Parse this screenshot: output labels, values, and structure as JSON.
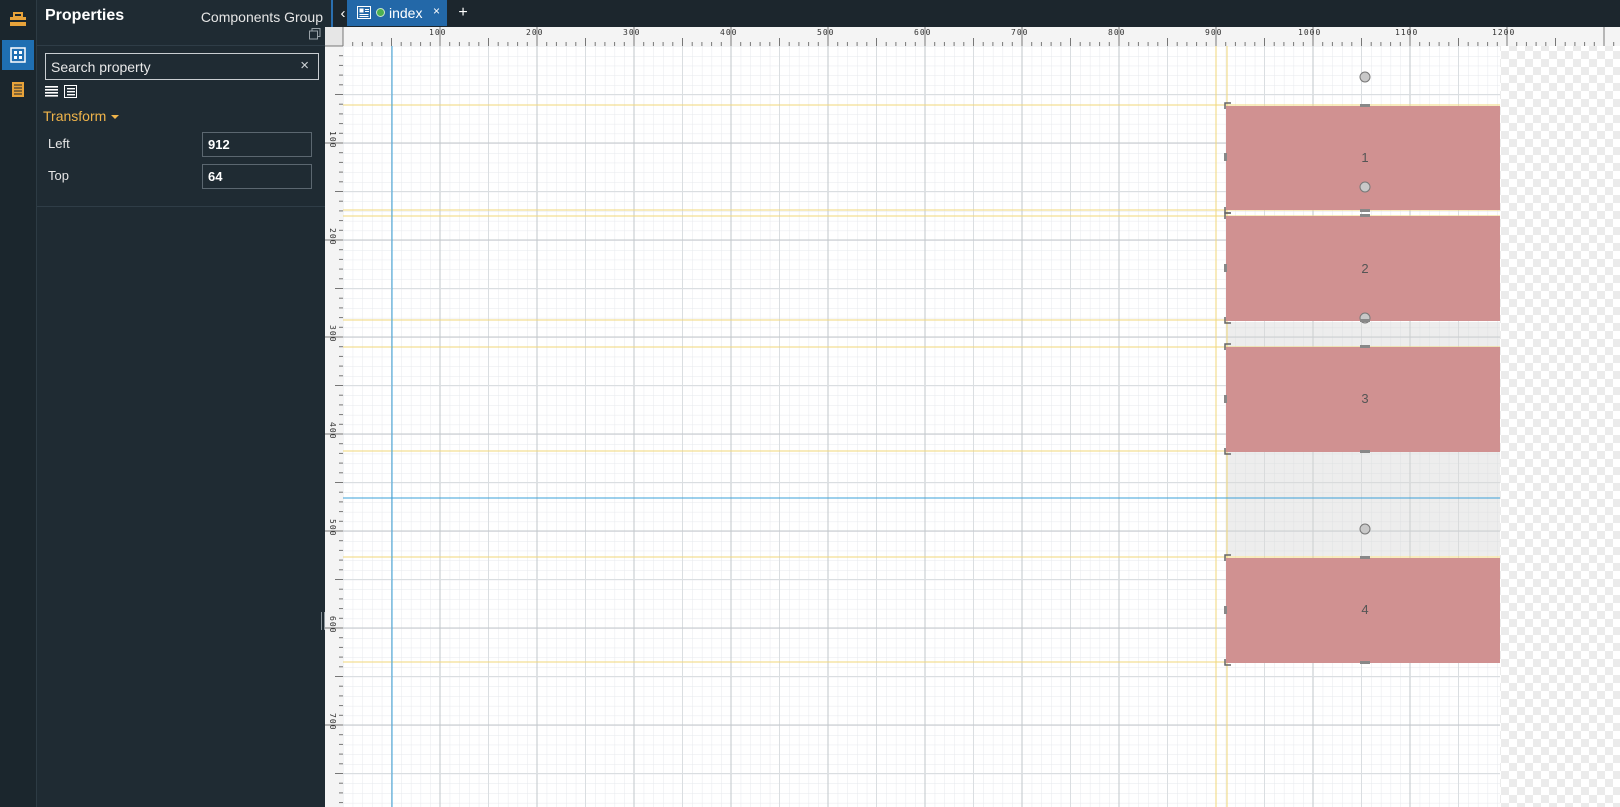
{
  "rail": {
    "items": [
      {
        "name": "toolbox-icon"
      },
      {
        "name": "layout-icon",
        "active": true
      },
      {
        "name": "page-icon"
      }
    ]
  },
  "panel": {
    "title": "Properties",
    "subtitle": "Components Group",
    "search_placeholder": "Search property",
    "search_clear": "×",
    "section": "Transform",
    "props": [
      {
        "label": "Left",
        "value": "912"
      },
      {
        "label": "Top",
        "value": "64"
      }
    ]
  },
  "tabs": {
    "back": "‹",
    "items": [
      {
        "label": "index",
        "close": "×",
        "active": true
      }
    ],
    "add": "+"
  },
  "canvas": {
    "ruler_x_labels": [
      "100",
      "200",
      "300",
      "400",
      "500",
      "600",
      "700",
      "800",
      "900",
      "1000",
      "1100",
      "1200"
    ],
    "ruler_y_labels": [
      "100",
      "200",
      "300",
      "400",
      "500",
      "600",
      "700"
    ],
    "components": [
      {
        "label": "1"
      },
      {
        "label": "2"
      },
      {
        "label": "3"
      },
      {
        "label": "4"
      }
    ],
    "component_color": "#d09191",
    "guide_color": "#f0d77a",
    "selection_color": "#3aa0d8"
  }
}
